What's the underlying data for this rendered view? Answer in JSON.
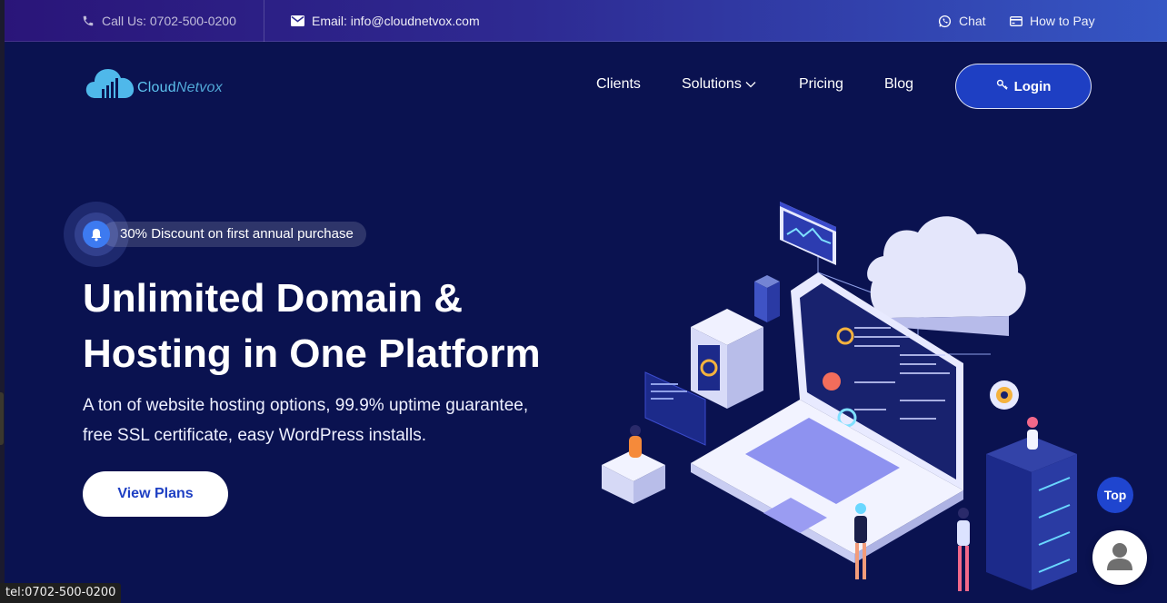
{
  "topbar": {
    "call": "Call Us: 0702-500-0200",
    "email": "Email: info@cloudnetvox.com",
    "chat": "Chat",
    "how_to_pay": "How to Pay"
  },
  "logo": {
    "part1": "Cloud",
    "part2": "Netvox"
  },
  "nav": {
    "items": [
      {
        "label": "Clients"
      },
      {
        "label": "Solutions"
      },
      {
        "label": "Pricing"
      },
      {
        "label": "Blog"
      }
    ],
    "login": "Login"
  },
  "hero": {
    "badge": "30% Discount on first annual purchase",
    "headline_line1": "Unlimited Domain &",
    "headline_line2": "Hosting in One Platform",
    "subtext_line1": "A ton of website hosting options, 99.9% uptime guarantee,",
    "subtext_line2": "free SSL certificate, easy WordPress installs.",
    "cta": "View Plans"
  },
  "floating": {
    "top": "Top"
  },
  "status_bar": "tel:0702-500-0200",
  "icons": [
    "phone-icon",
    "envelope-icon",
    "whatsapp-icon",
    "card-icon",
    "chevron-down-icon",
    "key-icon",
    "bell-icon",
    "avatar-icon"
  ],
  "colors": {
    "background": "#0a1250",
    "accent": "#1e3fc3",
    "topbar_start": "#2a1579",
    "topbar_end": "#3556c4"
  }
}
